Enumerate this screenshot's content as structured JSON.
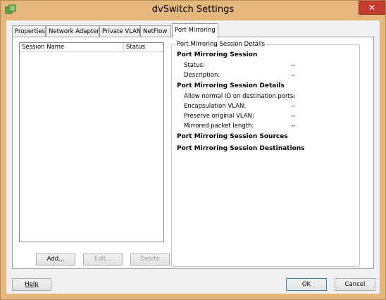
{
  "window": {
    "title": "dvSwitch Settings",
    "close_glyph": "✕"
  },
  "tabs": [
    {
      "label": "Properties"
    },
    {
      "label": "Network Adapters"
    },
    {
      "label": "Private VLAN"
    },
    {
      "label": "NetFlow"
    },
    {
      "label": "Port Mirroring"
    }
  ],
  "sessions_list": {
    "columns": [
      "Session Name",
      "Status"
    ],
    "rows": []
  },
  "list_buttons": {
    "add": "Add...",
    "edit": "Edit...",
    "delete": "Delete"
  },
  "details": {
    "group_title": "Port Mirroring Session Details",
    "session_heading": "Port Mirroring Session",
    "status_label": "Status:",
    "status_value": "--",
    "description_label": "Description:",
    "description_value": "--",
    "details_heading": "Port Mirroring Session Details",
    "normal_io_label": "Allow normal IO on destination ports:",
    "normal_io_value": "--",
    "encap_label": "Encapsulation VLAN:",
    "encap_value": "--",
    "preserve_label": "Preserve original VLAN:",
    "preserve_value": "--",
    "packet_len_label": "Mirrored packet length:",
    "packet_len_value": "--",
    "sources_heading": "Port Mirroring Session Sources",
    "destinations_heading": "Port Mirroring Session Destinations"
  },
  "footer": {
    "help": "Help",
    "ok": "OK",
    "cancel": "Cancel"
  }
}
